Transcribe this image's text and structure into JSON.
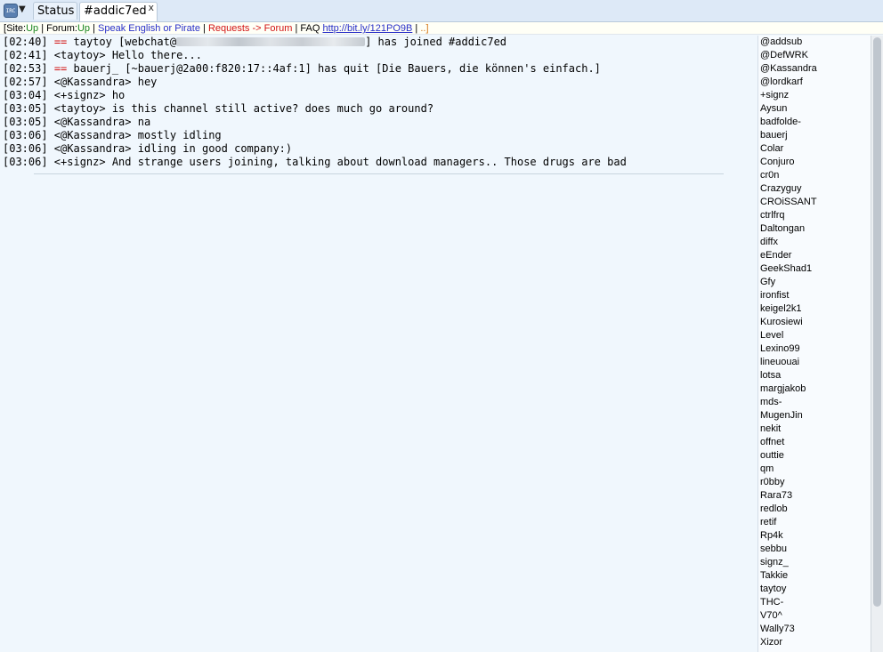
{
  "tabbar": {
    "menu_icon": "irc-menu-icon",
    "menu_arrow": "▼",
    "tabs": [
      {
        "label": "Status"
      },
      {
        "label": "#addic7ed",
        "close": "x"
      }
    ]
  },
  "topic": {
    "bracket_open": "[",
    "site_label": "Site:",
    "site_status": "Up",
    "sep1": " | ",
    "forum_label": "Forum:",
    "forum_status": "Up",
    "sep2": " | ",
    "speak": "Speak English or Pirate",
    "sep3": " | ",
    "requests": "Requests -> Forum",
    "sep4": " | ",
    "faq": "FAQ ",
    "faq_link": "http://bit.ly/121PO9B",
    "sep5": " | ",
    "ellipsis": "..]",
    "colors": {
      "green": "#18851e",
      "blue": "#2930c8",
      "red": "#d21414",
      "orange": "#d5781c"
    }
  },
  "chat": {
    "lines": [
      {
        "time": "[02:40]",
        "marker": "==",
        "text_a": " taytoy [webchat@",
        "text_b": "] has joined #addic7ed"
      },
      {
        "time": "[02:41]",
        "text": " <taytoy> Hello there..."
      },
      {
        "time": "[02:53]",
        "marker": "==",
        "text": " bauerj_ [~bauerj@2a00:f820:17::4af:1] has quit [Die Bauers, die können's einfach.]"
      },
      {
        "time": "[02:57]",
        "text": " <@Kassandra> hey"
      },
      {
        "time": "[03:04]",
        "text": " <+signz> ho"
      },
      {
        "time": "[03:05]",
        "text": " <taytoy> is this channel still active? does much go around?"
      },
      {
        "time": "[03:05]",
        "text": " <@Kassandra> na"
      },
      {
        "time": "[03:06]",
        "text": " <@Kassandra> mostly idling"
      },
      {
        "time": "[03:06]",
        "text": " <@Kassandra> idling in good company:)"
      },
      {
        "time": "[03:06]",
        "text": " <+signz> And strange users joining, talking about download managers.. Those drugs are bad"
      }
    ]
  },
  "users": [
    "@addsub",
    "@DefWRK",
    "@Kassandra",
    "@lordkarf",
    "+signz",
    "Aysun",
    "badfolde-",
    "bauerj",
    "Colar",
    "Conjuro",
    "cr0n",
    "Crazyguy",
    "CROiSSANT",
    "ctrlfrq",
    "Daltongan",
    "diffx",
    "eEnder",
    "GeekShad1",
    "Gfy",
    "ironfist",
    "keigel2k1",
    "Kurosiewi",
    "Level",
    "Lexino99",
    "lineuouai",
    "lotsa",
    "margjakob",
    "mds-",
    "MugenJin",
    "nekit",
    "offnet",
    "outtie",
    "qm",
    "r0bby",
    "Rara73",
    "redlob",
    "retif",
    "Rp4k",
    "sebbu",
    "signz_",
    "Takkie",
    "taytoy",
    "THC-",
    "V70^",
    "Wally73",
    "Xizor"
  ]
}
